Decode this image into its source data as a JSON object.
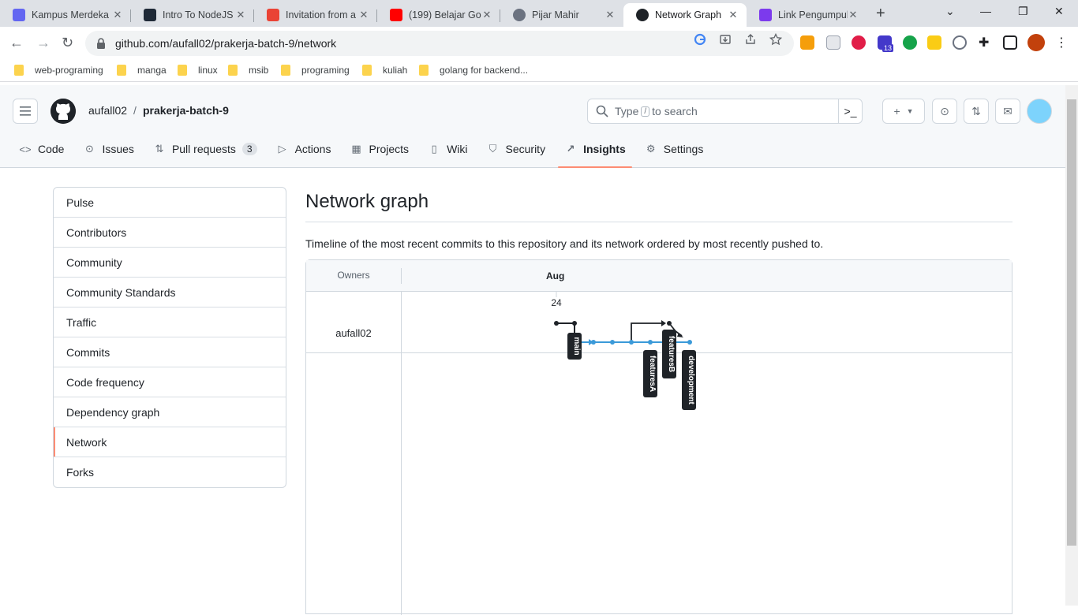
{
  "browser": {
    "tabs": [
      {
        "title": "Kampus Merdeka",
        "favicon_color": "#6366f1",
        "active": false
      },
      {
        "title": "Intro To NodeJS",
        "favicon_color": "#1f2937",
        "active": false
      },
      {
        "title": "Invitation from a",
        "favicon_color": "#ea4335",
        "active": false
      },
      {
        "title": "(199) Belajar Go-",
        "favicon_color": "#ff0000",
        "active": false
      },
      {
        "title": "Pijar Mahir",
        "favicon_color": "#6b7280",
        "active": false
      },
      {
        "title": "Network Graph",
        "favicon_color": "#1f2328",
        "active": true
      },
      {
        "title": "Link Pengumpula",
        "favicon_color": "#7c3aed",
        "active": false
      }
    ],
    "new_tab": "+",
    "url": "github.com/aufall02/prakerja-batch-9/network",
    "extension_badge": "13",
    "bookmarks": [
      "web-programing",
      "manga",
      "linux",
      "msib",
      "programing",
      "kuliah",
      "golang for backend..."
    ]
  },
  "github": {
    "owner": "aufall02",
    "slash": "/",
    "repo": "prakerja-batch-9",
    "search_prefix": "Type",
    "search_key": "/",
    "search_suffix": "to search",
    "nav": [
      {
        "label": "Code",
        "icon": "code-icon",
        "glyph": "<>"
      },
      {
        "label": "Issues",
        "icon": "issue-icon",
        "glyph": "⊙"
      },
      {
        "label": "Pull requests",
        "icon": "pull-request-icon",
        "glyph": "⇅",
        "count": "3"
      },
      {
        "label": "Actions",
        "icon": "play-icon",
        "glyph": "▷"
      },
      {
        "label": "Projects",
        "icon": "table-icon",
        "glyph": "▦"
      },
      {
        "label": "Wiki",
        "icon": "book-icon",
        "glyph": "▯"
      },
      {
        "label": "Security",
        "icon": "shield-icon",
        "glyph": "⛉"
      },
      {
        "label": "Insights",
        "icon": "graph-icon",
        "glyph": "↗",
        "selected": true
      },
      {
        "label": "Settings",
        "icon": "gear-icon",
        "glyph": "⚙"
      }
    ]
  },
  "sidebar": {
    "items": [
      "Pulse",
      "Contributors",
      "Community",
      "Community Standards",
      "Traffic",
      "Commits",
      "Code frequency",
      "Dependency graph",
      "Network",
      "Forks"
    ],
    "selected": "Network"
  },
  "main": {
    "title": "Network graph",
    "description": "Timeline of the most recent commits to this repository and its network ordered by most recently pushed to.",
    "owners_header": "Owners",
    "month": "Aug",
    "day": "24",
    "owner": "aufall02",
    "branches": [
      "main",
      "featuresA",
      "featuresB",
      "development"
    ],
    "colors": {
      "main_line": "#1f2328",
      "dev_line": "#3b9ad9",
      "accent": "#fd8c73"
    }
  }
}
